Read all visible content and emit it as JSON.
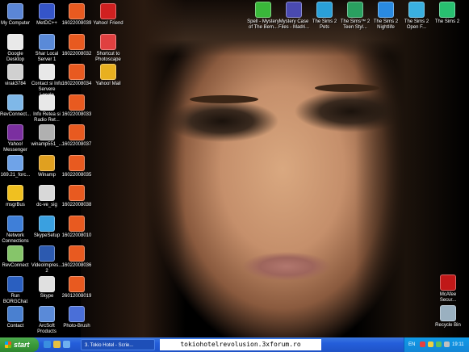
{
  "desktop": {
    "left_column": [
      {
        "label": "My Computer",
        "icon": "computer-icon",
        "color": "#5b86d6"
      },
      {
        "label": "Google Desktop",
        "icon": "google-desktop-icon",
        "color": "#e9e9e9"
      },
      {
        "label": "virak3784",
        "icon": "document-icon",
        "color": "#d0d0d0"
      },
      {
        "label": "RevConnect...",
        "icon": "revconnect-icon",
        "color": "#7fb8e8"
      },
      {
        "label": "Yahoo! Messenger",
        "icon": "yahoo-messenger-icon",
        "color": "#7b2fa0"
      },
      {
        "label": "169.21_forc...",
        "icon": "folder-icon",
        "color": "#6fa3e8"
      },
      {
        "label": "msgrBus",
        "icon": "smiley-icon",
        "color": "#f0c020"
      },
      {
        "label": "Network Connections",
        "icon": "network-icon",
        "color": "#3f7fd8"
      },
      {
        "label": "RevConnect",
        "icon": "revconnect-icon",
        "color": "#86c56a"
      },
      {
        "label": "Run BORGChat",
        "icon": "borgchat-icon",
        "color": "#2a5fc0"
      },
      {
        "label": "Contact",
        "icon": "contact-icon",
        "color": "#4a80d0"
      }
    ],
    "col2": [
      {
        "label": "MetDC++",
        "icon": "dcpp-icon",
        "color": "#3555c8"
      },
      {
        "label": "Shar Local Server 1",
        "icon": "shortcut-icon",
        "color": "#5a8ad8"
      },
      {
        "label": "Contact si Info Servere Locale",
        "icon": "text-file-icon",
        "color": "#e8e8e8"
      },
      {
        "label": "Info Retea si Radio Ret...",
        "icon": "text-file-icon",
        "color": "#e8e8e8"
      },
      {
        "label": "winamp551_...",
        "icon": "installer-icon",
        "color": "#b0b0b0"
      },
      {
        "label": "Winamp",
        "icon": "winamp-icon",
        "color": "#e0a020"
      },
      {
        "label": "dc-ve_sig",
        "icon": "image-file-icon",
        "color": "#d8d8d8"
      },
      {
        "label": "SkypeSetup",
        "icon": "skype-setup-icon",
        "color": "#3aa0e0"
      },
      {
        "label": "VideoImpres... 2",
        "icon": "video-icon",
        "color": "#2c5ab0"
      },
      {
        "label": "Skype",
        "icon": "document-icon",
        "color": "#e0e0e0"
      },
      {
        "label": "ArcSoft Products",
        "icon": "arcsoft-icon",
        "color": "#5a8ad8"
      }
    ],
    "col3": [
      {
        "label": "16022008039",
        "icon": "photo-file-icon",
        "color": "#e85a20"
      },
      {
        "label": "16022008032",
        "icon": "photo-file-icon",
        "color": "#e85a20"
      },
      {
        "label": "16022008034",
        "icon": "photo-file-icon",
        "color": "#e85a20"
      },
      {
        "label": "16022008033",
        "icon": "photo-file-icon",
        "color": "#e85a20"
      },
      {
        "label": "16022008037",
        "icon": "photo-file-icon",
        "color": "#e85a20"
      },
      {
        "label": "16022008035",
        "icon": "photo-file-icon",
        "color": "#e85a20"
      },
      {
        "label": "16022008038",
        "icon": "photo-file-icon",
        "color": "#e85a20"
      },
      {
        "label": "16022008010",
        "icon": "photo-file-icon",
        "color": "#e85a20"
      },
      {
        "label": "16022008036",
        "icon": "photo-file-icon",
        "color": "#e85a20"
      },
      {
        "label": "26012008019",
        "icon": "photo-file-icon",
        "color": "#e85a20"
      },
      {
        "label": "Photo-Brush",
        "icon": "photo-brush-icon",
        "color": "#4a6fd8"
      }
    ],
    "col4": [
      {
        "label": "Yahoo! Friend",
        "icon": "yahoo-icon",
        "color": "#d02020"
      },
      {
        "label": "Shortcut to Photoscape",
        "icon": "photoscape-icon",
        "color": "#e04040"
      },
      {
        "label": "Yahoo! Mail",
        "icon": "yahoo-mail-icon",
        "color": "#e8b020"
      }
    ],
    "top_row": [
      {
        "label": "Spell - Mystery of The Bem...",
        "icon": "game-icon",
        "color": "#3ab83a"
      },
      {
        "label": "Mystery Case Files - Madri...",
        "icon": "game-icon",
        "color": "#4a4ab0"
      },
      {
        "label": "The Sims 2 Pets",
        "icon": "sims-icon",
        "color": "#2aa0d8"
      },
      {
        "label": "The Sims™ 2 Teen Styl...",
        "icon": "sims-icon",
        "color": "#2aa060"
      },
      {
        "label": "The Sims 2 Nightlife",
        "icon": "sims-icon",
        "color": "#2a8ae0"
      },
      {
        "label": "The Sims 2 Open F...",
        "icon": "sims-icon",
        "color": "#3ab0e0"
      },
      {
        "label": "The Sims 2",
        "icon": "sims-icon",
        "color": "#28c070"
      }
    ],
    "right_column": [
      {
        "label": "McAfee Secur...",
        "icon": "mcafee-icon",
        "color": "#c01818"
      },
      {
        "label": "Recycle Bin",
        "icon": "recycle-bin-icon",
        "color": "#9ab0c0"
      }
    ]
  },
  "taskbar": {
    "start_label": "start",
    "task_label": "3. Tokio Hotel - Scrie...",
    "watermark": "tokiohotelrevolusion.3xforum.ro",
    "language": "EN",
    "clock": "19:11",
    "colors": {
      "bar": "#245edb",
      "start": "#3a9a3a",
      "tray": "#1486d6"
    }
  }
}
